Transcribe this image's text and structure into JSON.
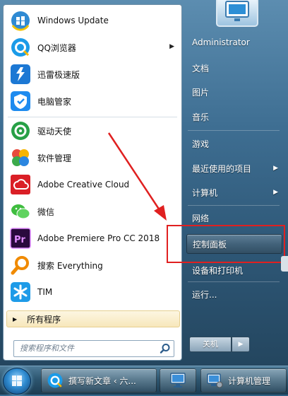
{
  "start_menu": {
    "pinned_programs": [
      {
        "label": "Windows Update",
        "icon": "windows-update-icon",
        "arrow": false
      },
      {
        "label": "QQ浏览器",
        "icon": "qq-browser-icon",
        "arrow": true
      },
      {
        "label": "迅雷极速版",
        "icon": "xunlei-icon",
        "arrow": false
      },
      {
        "label": "电脑管家",
        "icon": "pc-manager-icon",
        "arrow": false
      }
    ],
    "recent_programs": [
      {
        "label": "驱动天使",
        "icon": "driver-angel-icon"
      },
      {
        "label": "软件管理",
        "icon": "software-manager-icon"
      },
      {
        "label": "Adobe Creative Cloud",
        "icon": "creative-cloud-icon"
      },
      {
        "label": "微信",
        "icon": "wechat-icon"
      },
      {
        "label": "Adobe Premiere Pro CC 2018",
        "icon": "premiere-pro-icon"
      },
      {
        "label": "搜索 Everything",
        "icon": "everything-search-icon"
      },
      {
        "label": "TIM",
        "icon": "tim-icon"
      }
    ],
    "all_programs_label": "所有程序",
    "search_placeholder": "搜索程序和文件",
    "right_links": [
      {
        "label": "Administrator",
        "arrow": false
      },
      {
        "label": "文档",
        "arrow": false
      },
      {
        "label": "图片",
        "arrow": false
      },
      {
        "label": "音乐",
        "arrow": false
      },
      {
        "label": "游戏",
        "arrow": false
      },
      {
        "label": "最近使用的项目",
        "arrow": true
      },
      {
        "label": "计算机",
        "arrow": true
      },
      {
        "label": "网络",
        "arrow": false
      },
      {
        "label": "控制面板",
        "arrow": false,
        "highlighted": true
      },
      {
        "label": "设备和打印机",
        "arrow": false
      },
      {
        "label": "运行...",
        "arrow": false
      }
    ],
    "shutdown_label": "关机"
  },
  "taskbar": {
    "buttons": [
      {
        "label": "撰写新文章 ‹ 六...",
        "icon": "qq-browser-icon"
      },
      {
        "label": "",
        "icon": "remote-desktop-icon"
      },
      {
        "label": "计算机管理",
        "icon": "computer-management-icon"
      }
    ]
  },
  "colors": {
    "annotation_red": "#e02020",
    "menu_glass": "#3e6e92"
  }
}
